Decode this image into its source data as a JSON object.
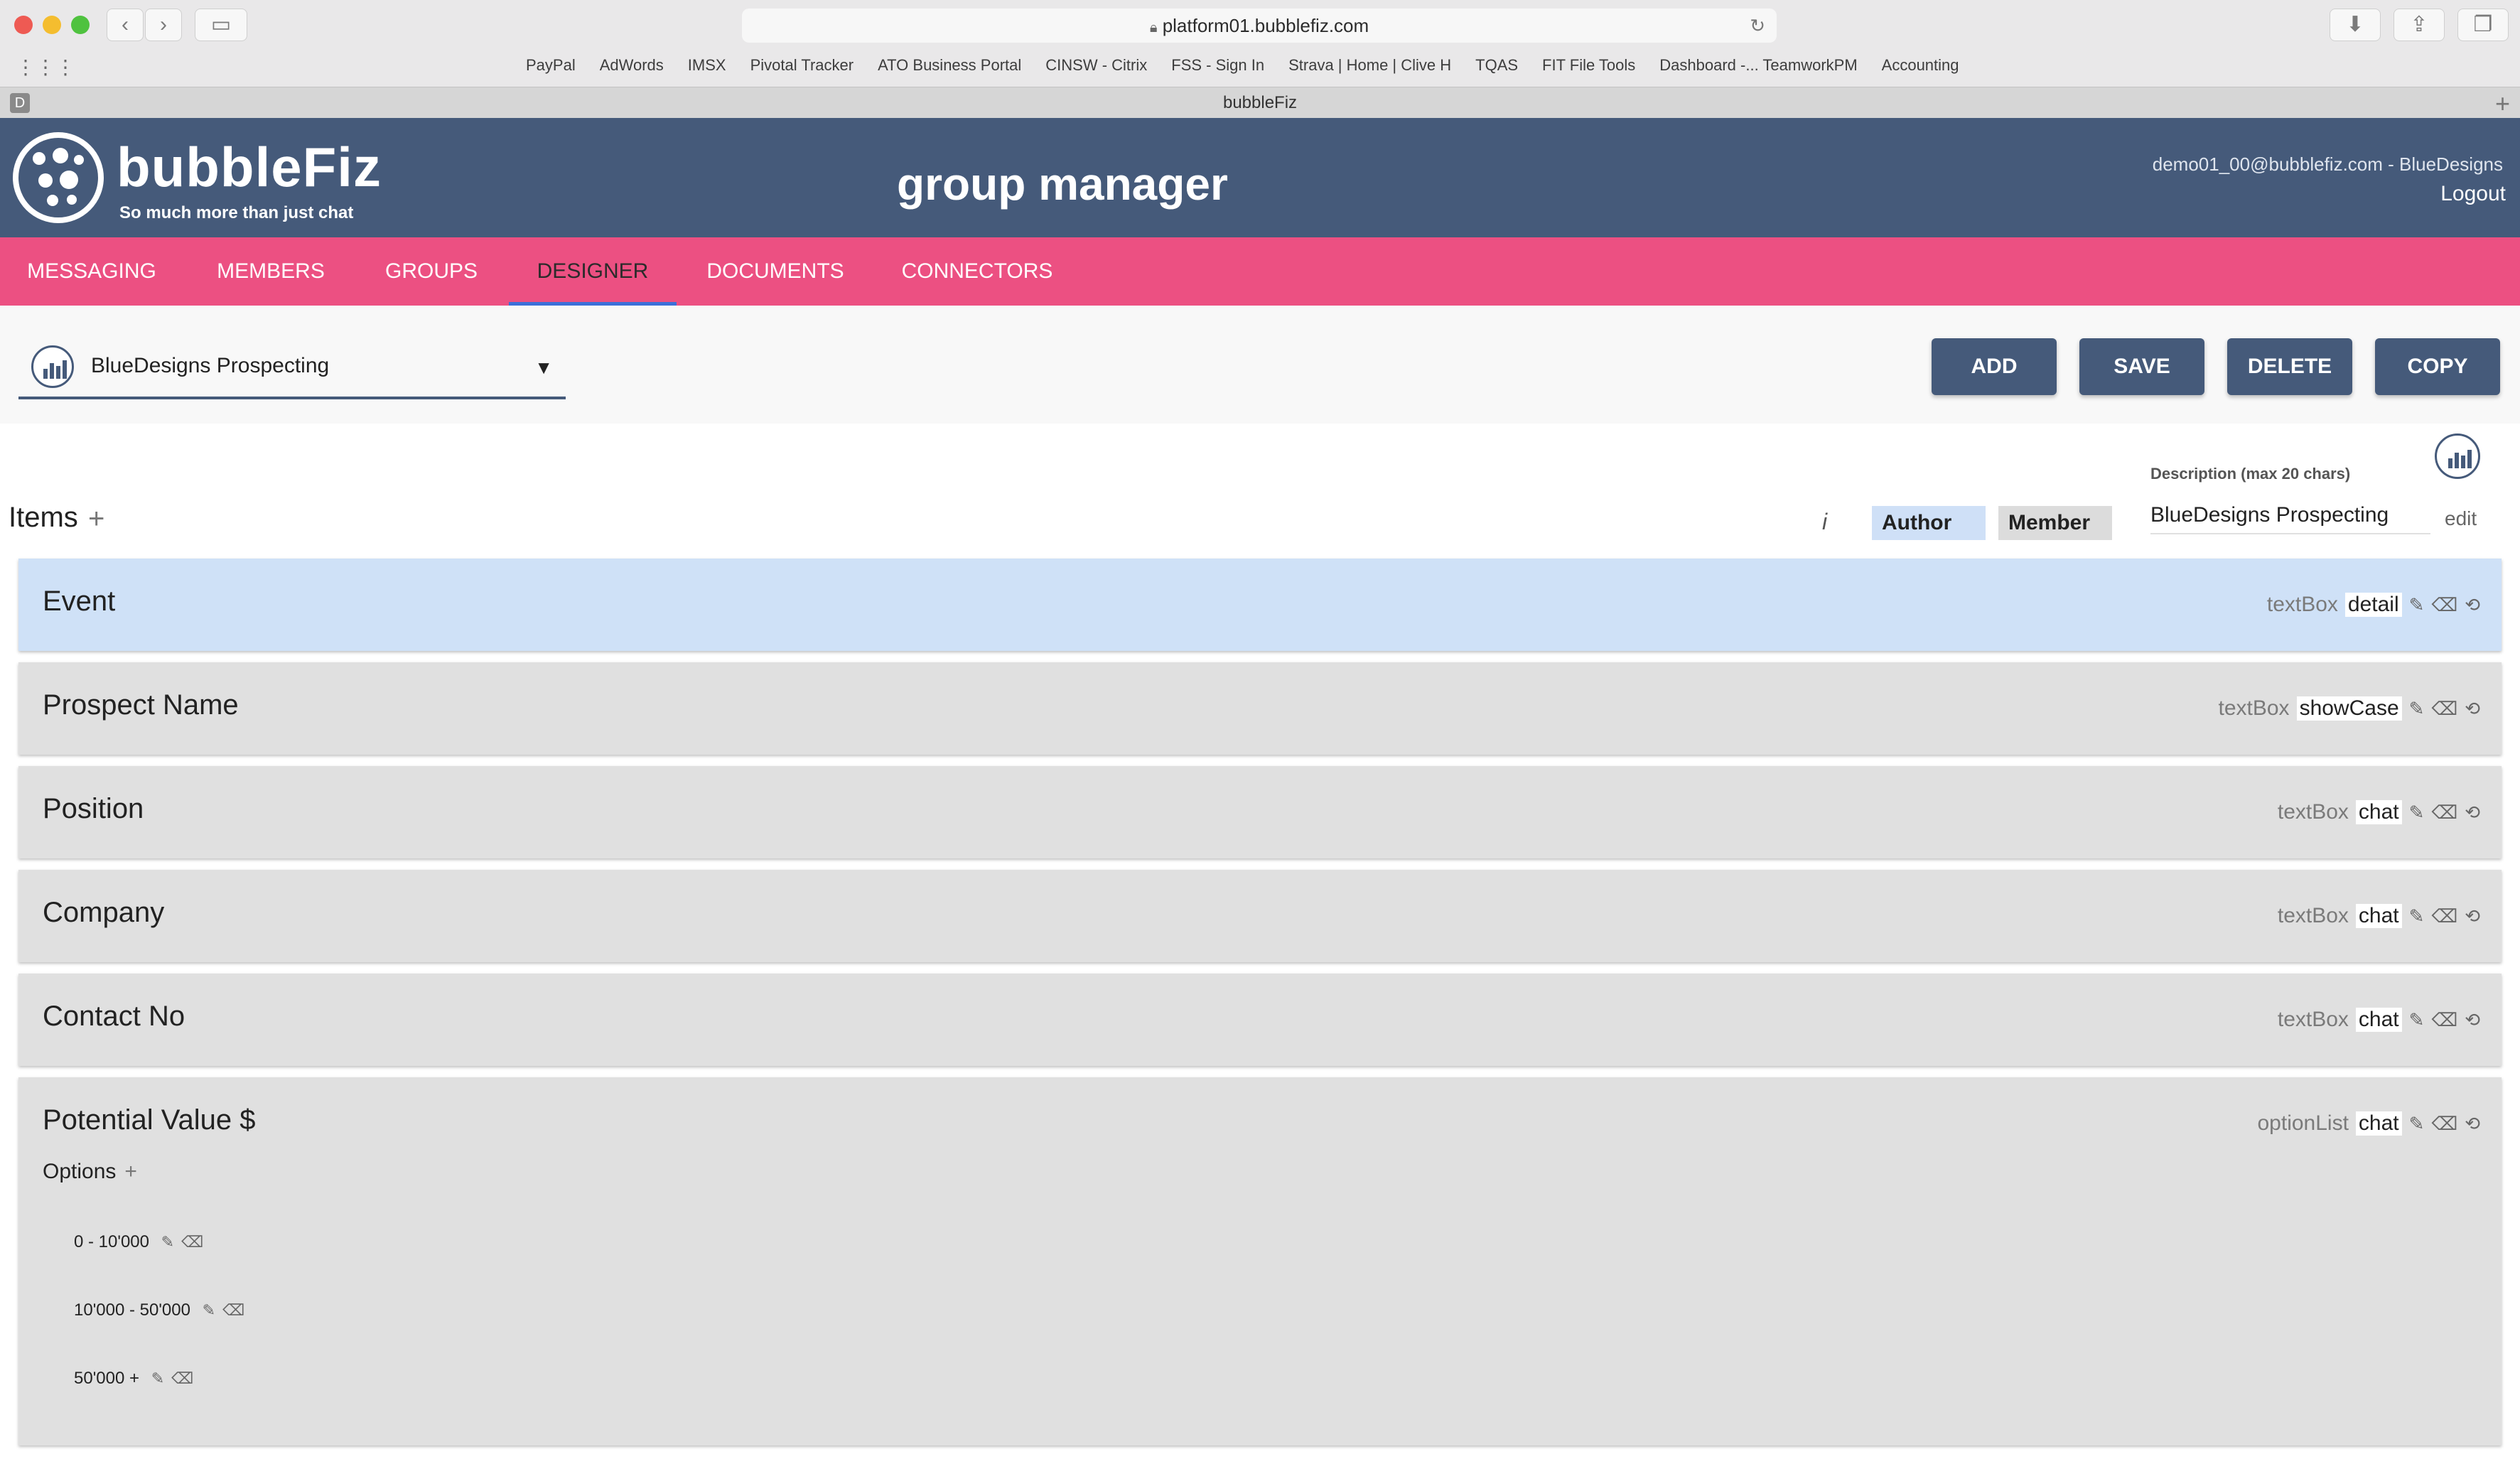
{
  "browser": {
    "url": "platform01.bubblefiz.com",
    "bookmarks": [
      "PayPal",
      "AdWords",
      "IMSX",
      "Pivotal Tracker",
      "ATO Business Portal",
      "CINSW - Citrix",
      "FSS - Sign In",
      "Strava | Home | Clive H",
      "TQAS",
      "FIT File Tools",
      "Dashboard -... TeamworkPM",
      "Accounting"
    ],
    "tab_title": "bubbleFiz",
    "tab_badge": "D"
  },
  "header": {
    "logo_text": "bubbleFiz",
    "tagline": "So much more than just chat",
    "title": "group manager",
    "user": "demo01_00@bubblefiz.com - BlueDesigns",
    "logout": "Logout",
    "bg_color": "#455a7a"
  },
  "menu": {
    "items": [
      "MESSAGING",
      "MEMBERS",
      "GROUPS",
      "DESIGNER",
      "DOCUMENTS",
      "CONNECTORS"
    ],
    "active": "DESIGNER",
    "bg_color": "#ec5082"
  },
  "toolbar": {
    "template_name": "BlueDesigns Prospecting",
    "buttons": {
      "add": "ADD",
      "save": "SAVE",
      "delete": "DELETE",
      "copy": "COPY"
    }
  },
  "items_section": {
    "title": "Items",
    "plus": "+",
    "info": "i",
    "author_label": "Author",
    "member_label": "Member",
    "description_label": "Description (max 20 chars)",
    "description_value": "BlueDesigns Prospecting",
    "edit_label": "edit"
  },
  "rows": [
    {
      "label": "Event",
      "type": "textBox",
      "show": "detail"
    },
    {
      "label": "Prospect Name",
      "type": "textBox",
      "show": "showCase"
    },
    {
      "label": "Position",
      "type": "textBox",
      "show": "chat"
    },
    {
      "label": "Company",
      "type": "textBox",
      "show": "chat"
    },
    {
      "label": "Contact No",
      "type": "textBox",
      "show": "chat"
    },
    {
      "label": "Potential Value $",
      "type": "optionList",
      "show": "chat",
      "options_label": "Options",
      "options": [
        "0 - 10'000",
        "10'000 - 50'000",
        "50'000 +"
      ]
    }
  ],
  "icons": {
    "edit": "pencil-icon",
    "delete": "backspace-icon",
    "reorder": "repeat-icon",
    "add": "plus-icon",
    "chart": "bar-chart-icon"
  }
}
